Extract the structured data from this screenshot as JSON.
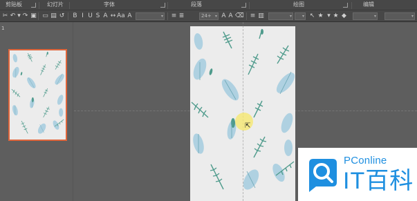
{
  "ribbon": {
    "groups": [
      {
        "label": "剪贴板"
      },
      {
        "label": "幻灯片"
      },
      {
        "label": "字体"
      },
      {
        "label": "段落"
      },
      {
        "label": "绘图"
      },
      {
        "label": "编辑"
      }
    ]
  },
  "toolbar": {
    "font_size_value": "24+"
  },
  "thumbnails": {
    "slide_number": "1"
  },
  "watermark": {
    "brand": "PConline",
    "title": "IT百科"
  },
  "colors": {
    "accent_selection": "#e0653a",
    "leaf_green": "#4f9b8c",
    "leaf_blue": "#a9cfe0",
    "brand_blue": "#1e8fe0",
    "cursor_highlight": "#f6e86e"
  }
}
